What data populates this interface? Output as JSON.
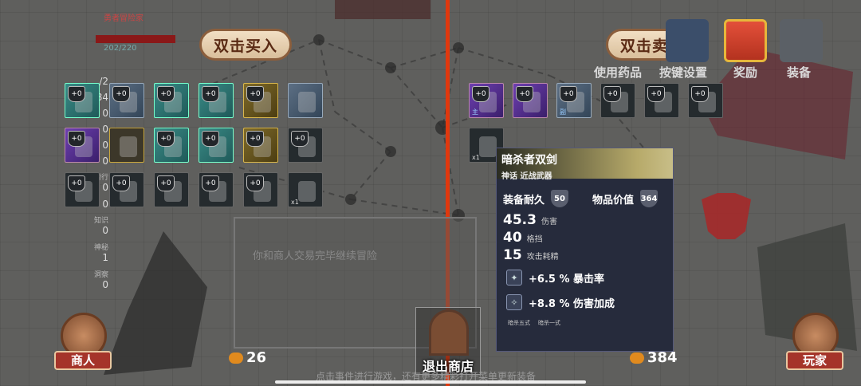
{
  "player": {
    "hp_text": "202/220",
    "armor": "384"
  },
  "stats": [
    {
      "label": "",
      "value": "/2"
    },
    {
      "label": "",
      "value": "384"
    },
    {
      "label": "",
      "value": "0"
    },
    {
      "label": "",
      "value": "0"
    },
    {
      "label": "",
      "value": "0"
    },
    {
      "label": "",
      "value": "0"
    },
    {
      "label": "滑行",
      "value": "0"
    },
    {
      "label": "",
      "value": "0"
    },
    {
      "label": "知识",
      "value": "0"
    },
    {
      "label": "神秘",
      "value": "1"
    },
    {
      "label": "洞察",
      "value": "0"
    }
  ],
  "banners": {
    "buy": "双击买入",
    "sell": "双击卖出"
  },
  "top_buttons": [
    {
      "label": "使用药品",
      "icon": "potion-icon"
    },
    {
      "label": "按键设置",
      "icon": "keys-icon"
    },
    {
      "label": "奖励",
      "icon": "gift-icon"
    },
    {
      "label": "装备",
      "icon": "helmet-icon"
    }
  ],
  "merchant_items": [
    {
      "plus": "+0",
      "count": "",
      "rarity": "teal",
      "icon": "halberd-icon"
    },
    {
      "plus": "+0",
      "count": "",
      "rarity": "steel",
      "icon": "mace-icon"
    },
    {
      "plus": "+0",
      "count": "",
      "rarity": "teal",
      "icon": "axe-icon"
    },
    {
      "plus": "+0",
      "count": "",
      "rarity": "teal",
      "icon": "axe-icon"
    },
    {
      "plus": "+0",
      "count": "",
      "rarity": "gold",
      "icon": "spear-icon"
    },
    {
      "plus": "",
      "count": "",
      "rarity": "steel",
      "icon": "greave-icon"
    },
    {
      "plus": "+0",
      "count": "",
      "rarity": "purple",
      "icon": "chestplate-icon"
    },
    {
      "plus": "",
      "count": "",
      "rarity": "sand",
      "icon": "cloak-icon"
    },
    {
      "plus": "+0",
      "count": "",
      "rarity": "teal",
      "icon": "bracer-icon"
    },
    {
      "plus": "+0",
      "count": "",
      "rarity": "teal",
      "icon": "gauntlet-icon"
    },
    {
      "plus": "+0",
      "count": "",
      "rarity": "gold",
      "icon": "amulet-icon"
    },
    {
      "plus": "+0",
      "count": "",
      "rarity": "dark",
      "icon": "boot-icon"
    },
    {
      "plus": "+0",
      "count": "",
      "rarity": "dark",
      "icon": "mace-icon"
    },
    {
      "plus": "+0",
      "count": "",
      "rarity": "dark",
      "icon": "glove-icon"
    },
    {
      "plus": "+0",
      "count": "",
      "rarity": "dark",
      "icon": "boot-icon"
    },
    {
      "plus": "+0",
      "count": "",
      "rarity": "dark",
      "icon": "halberd-icon"
    },
    {
      "plus": "+0",
      "count": "",
      "rarity": "dark",
      "icon": "gauntlet-icon"
    },
    {
      "plus": "",
      "count": "x1",
      "rarity": "dark",
      "icon": "spider-icon"
    }
  ],
  "player_items": [
    {
      "plus": "+0",
      "tag": "主",
      "rarity": "purple",
      "icon": "dual-swords-icon"
    },
    {
      "plus": "+0",
      "tag": "",
      "rarity": "purple",
      "icon": "boot-icon"
    },
    {
      "plus": "+0",
      "tag": "副",
      "rarity": "steel",
      "icon": "spear-icon"
    },
    {
      "plus": "+0",
      "tag": "",
      "rarity": "dark",
      "icon": "chestplate-icon"
    },
    {
      "plus": "+0",
      "tag": "",
      "rarity": "dark",
      "icon": "gauntlet-icon"
    },
    {
      "plus": "+0",
      "tag": "",
      "rarity": "dark",
      "icon": "glove-icon"
    },
    {
      "plus": "",
      "count": "x1",
      "rarity": "dark",
      "icon": "meat-icon"
    }
  ],
  "tooltip": {
    "name": "暗杀者双剑",
    "subtitle": "神话 近战武器",
    "durability_label": "装备耐久",
    "durability": "50",
    "value_label": "物品价值",
    "value": "364",
    "stats": [
      {
        "value": "45.3",
        "label": "伤害"
      },
      {
        "value": "40",
        "label": "格挡"
      },
      {
        "value": "15",
        "label": "攻击耗精"
      }
    ],
    "affixes": [
      {
        "text": "+6.5 % 暴击率",
        "icon": "crit-icon"
      },
      {
        "text": "+8.8 % 伤害加成",
        "icon": "damage-icon"
      }
    ],
    "skills": [
      "暗杀五式",
      "暗杀一式"
    ]
  },
  "merchant_coins": "26",
  "player_coins": "384",
  "exit_label": "退出商店",
  "merchant_label": "商人",
  "player_label": "玩家",
  "dialog_text": "你和商人交易完毕继续冒险",
  "hint_text": "点击事件进行游戏，还有更多精彩打开菜单更新装备"
}
